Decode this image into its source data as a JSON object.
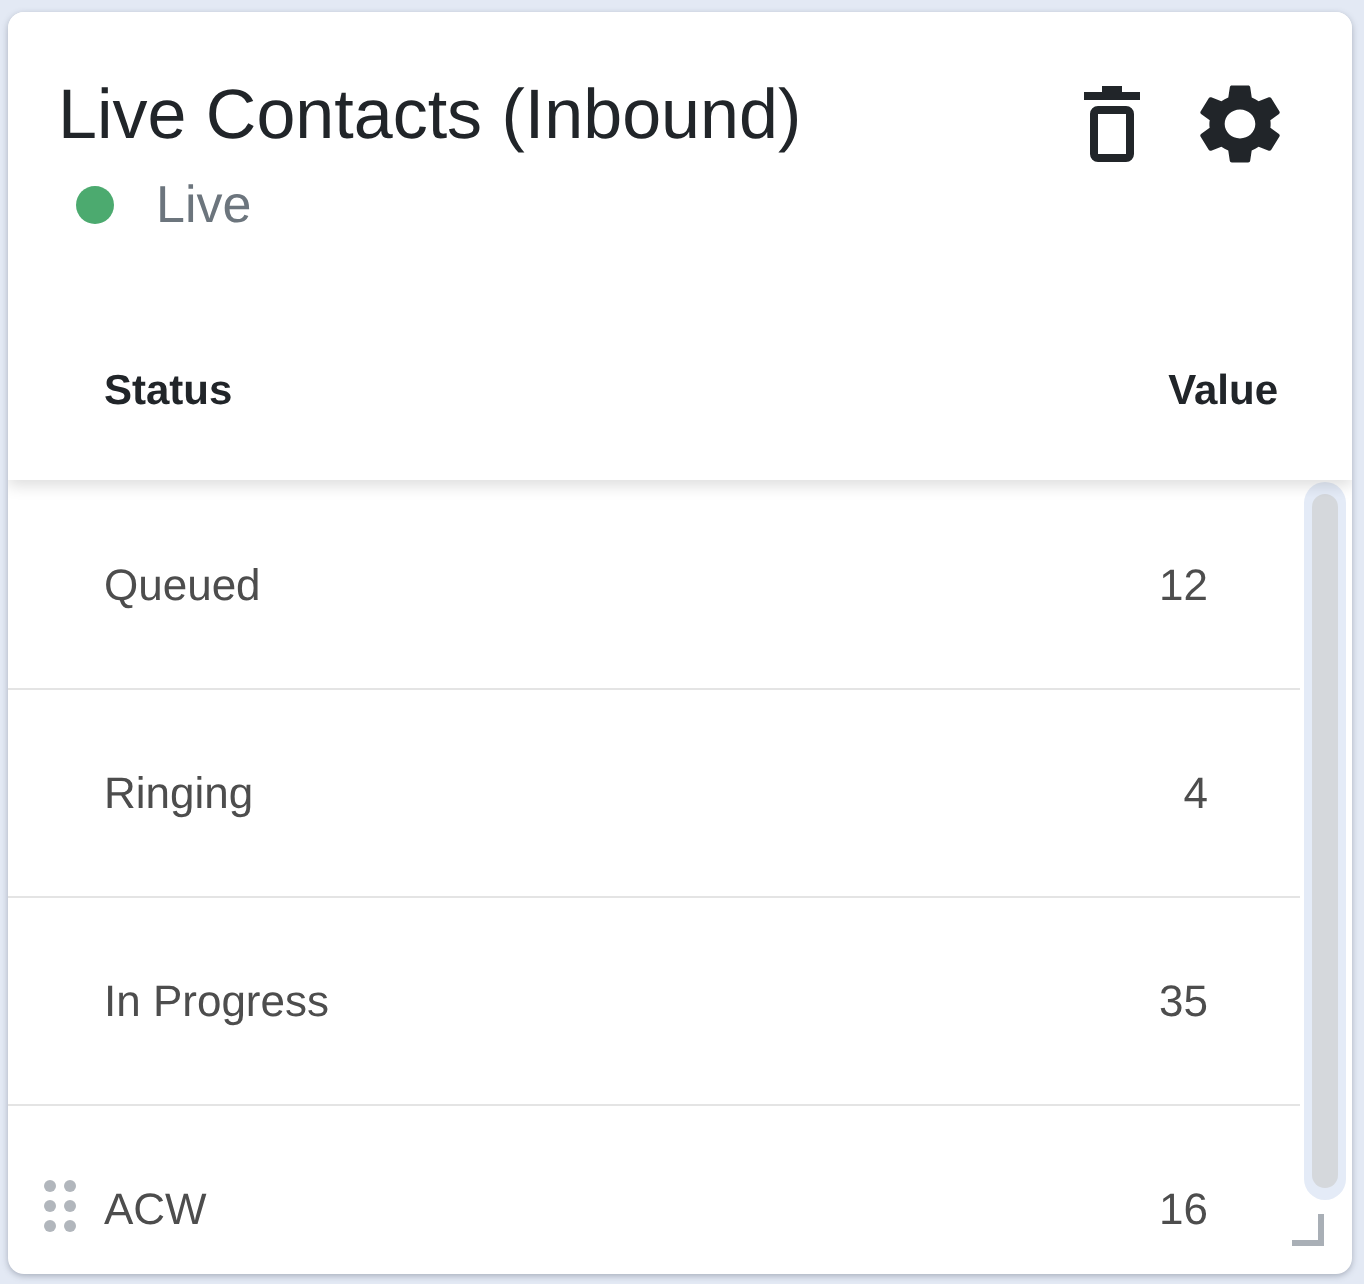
{
  "widget": {
    "title": "Live Contacts (Inbound)",
    "status": {
      "label": "Live",
      "color": "#4caa6f"
    }
  },
  "table": {
    "columns": [
      "Status",
      "Value"
    ],
    "rows": [
      {
        "status": "Queued",
        "value": "12"
      },
      {
        "status": "Ringing",
        "value": "4"
      },
      {
        "status": "In Progress",
        "value": "35"
      },
      {
        "status": "ACW",
        "value": "16"
      }
    ]
  }
}
